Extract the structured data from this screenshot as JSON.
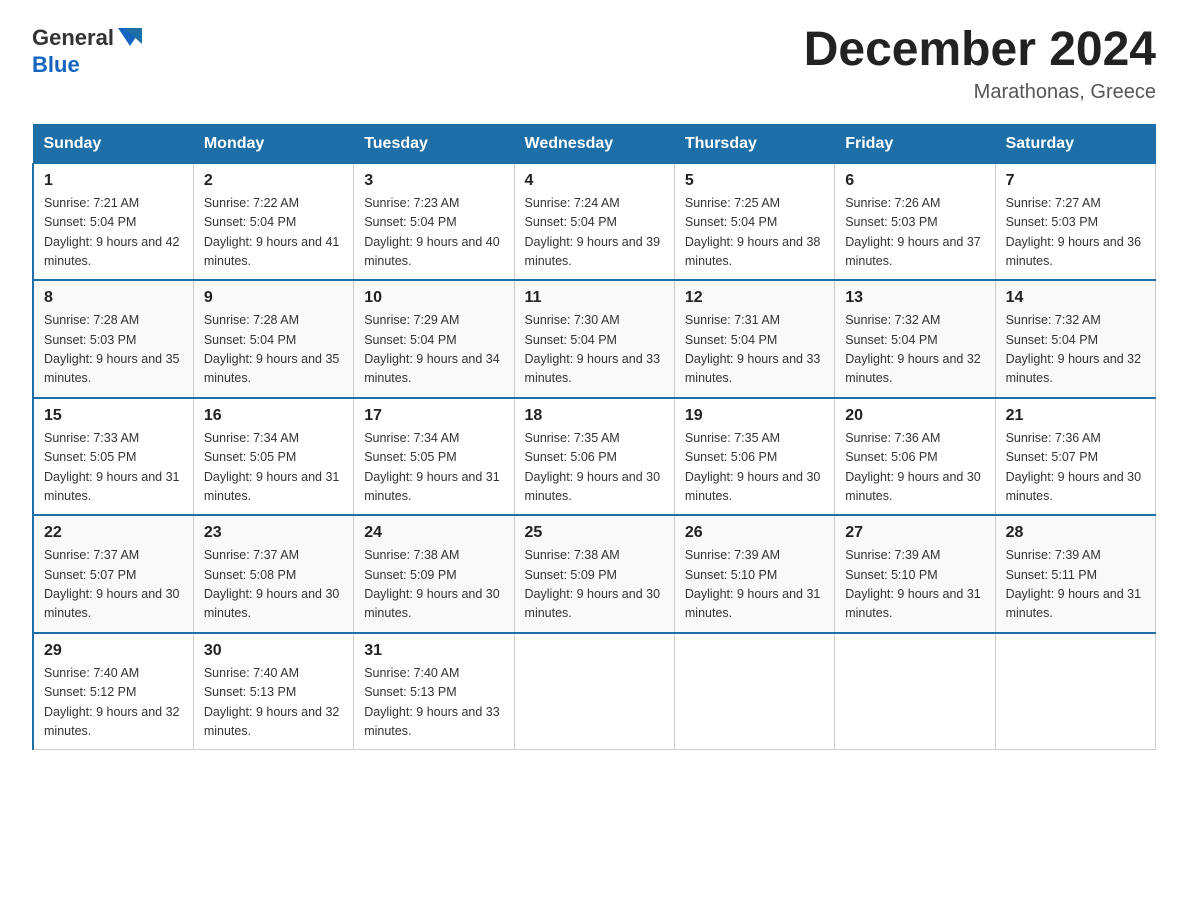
{
  "logo": {
    "text_general": "General",
    "triangle_icon": "▶",
    "text_blue": "Blue"
  },
  "title": "December 2024",
  "location": "Marathonas, Greece",
  "days_of_week": [
    "Sunday",
    "Monday",
    "Tuesday",
    "Wednesday",
    "Thursday",
    "Friday",
    "Saturday"
  ],
  "weeks": [
    [
      {
        "day": "1",
        "sunrise": "Sunrise: 7:21 AM",
        "sunset": "Sunset: 5:04 PM",
        "daylight": "Daylight: 9 hours and 42 minutes."
      },
      {
        "day": "2",
        "sunrise": "Sunrise: 7:22 AM",
        "sunset": "Sunset: 5:04 PM",
        "daylight": "Daylight: 9 hours and 41 minutes."
      },
      {
        "day": "3",
        "sunrise": "Sunrise: 7:23 AM",
        "sunset": "Sunset: 5:04 PM",
        "daylight": "Daylight: 9 hours and 40 minutes."
      },
      {
        "day": "4",
        "sunrise": "Sunrise: 7:24 AM",
        "sunset": "Sunset: 5:04 PM",
        "daylight": "Daylight: 9 hours and 39 minutes."
      },
      {
        "day": "5",
        "sunrise": "Sunrise: 7:25 AM",
        "sunset": "Sunset: 5:04 PM",
        "daylight": "Daylight: 9 hours and 38 minutes."
      },
      {
        "day": "6",
        "sunrise": "Sunrise: 7:26 AM",
        "sunset": "Sunset: 5:03 PM",
        "daylight": "Daylight: 9 hours and 37 minutes."
      },
      {
        "day": "7",
        "sunrise": "Sunrise: 7:27 AM",
        "sunset": "Sunset: 5:03 PM",
        "daylight": "Daylight: 9 hours and 36 minutes."
      }
    ],
    [
      {
        "day": "8",
        "sunrise": "Sunrise: 7:28 AM",
        "sunset": "Sunset: 5:03 PM",
        "daylight": "Daylight: 9 hours and 35 minutes."
      },
      {
        "day": "9",
        "sunrise": "Sunrise: 7:28 AM",
        "sunset": "Sunset: 5:04 PM",
        "daylight": "Daylight: 9 hours and 35 minutes."
      },
      {
        "day": "10",
        "sunrise": "Sunrise: 7:29 AM",
        "sunset": "Sunset: 5:04 PM",
        "daylight": "Daylight: 9 hours and 34 minutes."
      },
      {
        "day": "11",
        "sunrise": "Sunrise: 7:30 AM",
        "sunset": "Sunset: 5:04 PM",
        "daylight": "Daylight: 9 hours and 33 minutes."
      },
      {
        "day": "12",
        "sunrise": "Sunrise: 7:31 AM",
        "sunset": "Sunset: 5:04 PM",
        "daylight": "Daylight: 9 hours and 33 minutes."
      },
      {
        "day": "13",
        "sunrise": "Sunrise: 7:32 AM",
        "sunset": "Sunset: 5:04 PM",
        "daylight": "Daylight: 9 hours and 32 minutes."
      },
      {
        "day": "14",
        "sunrise": "Sunrise: 7:32 AM",
        "sunset": "Sunset: 5:04 PM",
        "daylight": "Daylight: 9 hours and 32 minutes."
      }
    ],
    [
      {
        "day": "15",
        "sunrise": "Sunrise: 7:33 AM",
        "sunset": "Sunset: 5:05 PM",
        "daylight": "Daylight: 9 hours and 31 minutes."
      },
      {
        "day": "16",
        "sunrise": "Sunrise: 7:34 AM",
        "sunset": "Sunset: 5:05 PM",
        "daylight": "Daylight: 9 hours and 31 minutes."
      },
      {
        "day": "17",
        "sunrise": "Sunrise: 7:34 AM",
        "sunset": "Sunset: 5:05 PM",
        "daylight": "Daylight: 9 hours and 31 minutes."
      },
      {
        "day": "18",
        "sunrise": "Sunrise: 7:35 AM",
        "sunset": "Sunset: 5:06 PM",
        "daylight": "Daylight: 9 hours and 30 minutes."
      },
      {
        "day": "19",
        "sunrise": "Sunrise: 7:35 AM",
        "sunset": "Sunset: 5:06 PM",
        "daylight": "Daylight: 9 hours and 30 minutes."
      },
      {
        "day": "20",
        "sunrise": "Sunrise: 7:36 AM",
        "sunset": "Sunset: 5:06 PM",
        "daylight": "Daylight: 9 hours and 30 minutes."
      },
      {
        "day": "21",
        "sunrise": "Sunrise: 7:36 AM",
        "sunset": "Sunset: 5:07 PM",
        "daylight": "Daylight: 9 hours and 30 minutes."
      }
    ],
    [
      {
        "day": "22",
        "sunrise": "Sunrise: 7:37 AM",
        "sunset": "Sunset: 5:07 PM",
        "daylight": "Daylight: 9 hours and 30 minutes."
      },
      {
        "day": "23",
        "sunrise": "Sunrise: 7:37 AM",
        "sunset": "Sunset: 5:08 PM",
        "daylight": "Daylight: 9 hours and 30 minutes."
      },
      {
        "day": "24",
        "sunrise": "Sunrise: 7:38 AM",
        "sunset": "Sunset: 5:09 PM",
        "daylight": "Daylight: 9 hours and 30 minutes."
      },
      {
        "day": "25",
        "sunrise": "Sunrise: 7:38 AM",
        "sunset": "Sunset: 5:09 PM",
        "daylight": "Daylight: 9 hours and 30 minutes."
      },
      {
        "day": "26",
        "sunrise": "Sunrise: 7:39 AM",
        "sunset": "Sunset: 5:10 PM",
        "daylight": "Daylight: 9 hours and 31 minutes."
      },
      {
        "day": "27",
        "sunrise": "Sunrise: 7:39 AM",
        "sunset": "Sunset: 5:10 PM",
        "daylight": "Daylight: 9 hours and 31 minutes."
      },
      {
        "day": "28",
        "sunrise": "Sunrise: 7:39 AM",
        "sunset": "Sunset: 5:11 PM",
        "daylight": "Daylight: 9 hours and 31 minutes."
      }
    ],
    [
      {
        "day": "29",
        "sunrise": "Sunrise: 7:40 AM",
        "sunset": "Sunset: 5:12 PM",
        "daylight": "Daylight: 9 hours and 32 minutes."
      },
      {
        "day": "30",
        "sunrise": "Sunrise: 7:40 AM",
        "sunset": "Sunset: 5:13 PM",
        "daylight": "Daylight: 9 hours and 32 minutes."
      },
      {
        "day": "31",
        "sunrise": "Sunrise: 7:40 AM",
        "sunset": "Sunset: 5:13 PM",
        "daylight": "Daylight: 9 hours and 33 minutes."
      },
      null,
      null,
      null,
      null
    ]
  ]
}
